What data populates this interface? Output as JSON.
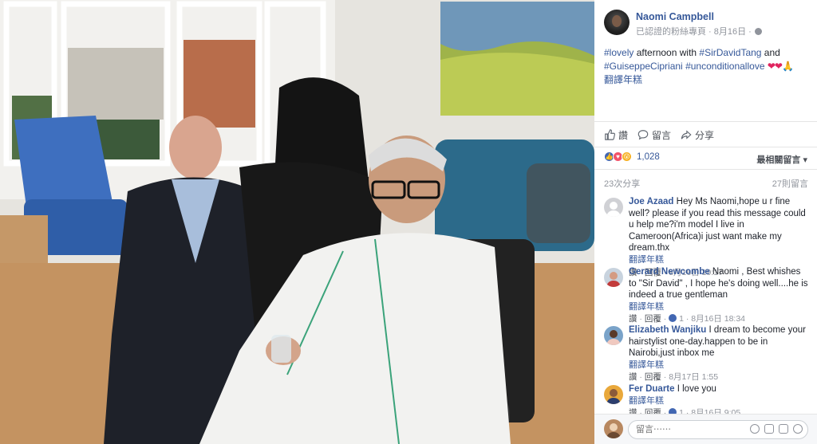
{
  "post": {
    "author": "Naomi Campbell",
    "meta": "已認證的粉絲專頁 · 8月16日 ·",
    "text_parts": [
      {
        "t": "#lovely",
        "tag": true
      },
      {
        "t": " afternoon with ",
        "tag": false
      },
      {
        "t": "#SirDavidTang",
        "tag": true
      },
      {
        "t": " and ",
        "tag": false
      },
      {
        "t": "#GuiseppeCipriani",
        "tag": true
      },
      {
        "t": " ",
        "tag": false
      },
      {
        "t": "#unconditionallove",
        "tag": true
      }
    ],
    "emoji": "❤❤🙏",
    "translate": "翻譯年糕"
  },
  "actions": {
    "like": "讚",
    "comment": "留言",
    "share": "分享"
  },
  "reactions": {
    "count": "1,028",
    "sort": "最相關留言 ▾"
  },
  "stats": {
    "shares": "23次分享",
    "comments": "27則留言"
  },
  "comments": [
    {
      "name": "Joe Azaad",
      "text": "Hey Ms Naomi,hope u r fine well? please if you read this message could u help me?i'm model I live in Cameroon(Africa)i just want make my dream.thx",
      "translate": "翻譯年糕",
      "like": "讚",
      "reply": "回覆",
      "likes": "",
      "time": "8月16日 19:17"
    },
    {
      "name": "Gerard Newcombe",
      "text": "Naomi , Best whishes to \"Sir David\" , I hope he's doing well....he is indeed a true gentleman",
      "translate": "翻譯年糕",
      "like": "讚",
      "reply": "回覆",
      "likes": "1",
      "time": "8月16日 18:34"
    },
    {
      "name": "Elizabeth Wanjiku",
      "text": "I dream to become your hairstylist one-day.happen to be in Nairobi,just inbox me",
      "translate": "翻譯年糕",
      "like": "讚",
      "reply": "回覆",
      "likes": "",
      "time": "8月17日 1:55"
    },
    {
      "name": "Fer Duarte",
      "text": "I love you",
      "translate": "翻譯年糕",
      "like": "讚",
      "reply": "回覆",
      "likes": "1",
      "time": "8月16日 9:05"
    }
  ],
  "composer": {
    "placeholder": "留言⋯⋯"
  },
  "colors": {
    "link": "#365899",
    "text": "#1d2129",
    "muted": "#90949c",
    "like_blue": "#4267b2",
    "love_red": "#f25268"
  }
}
